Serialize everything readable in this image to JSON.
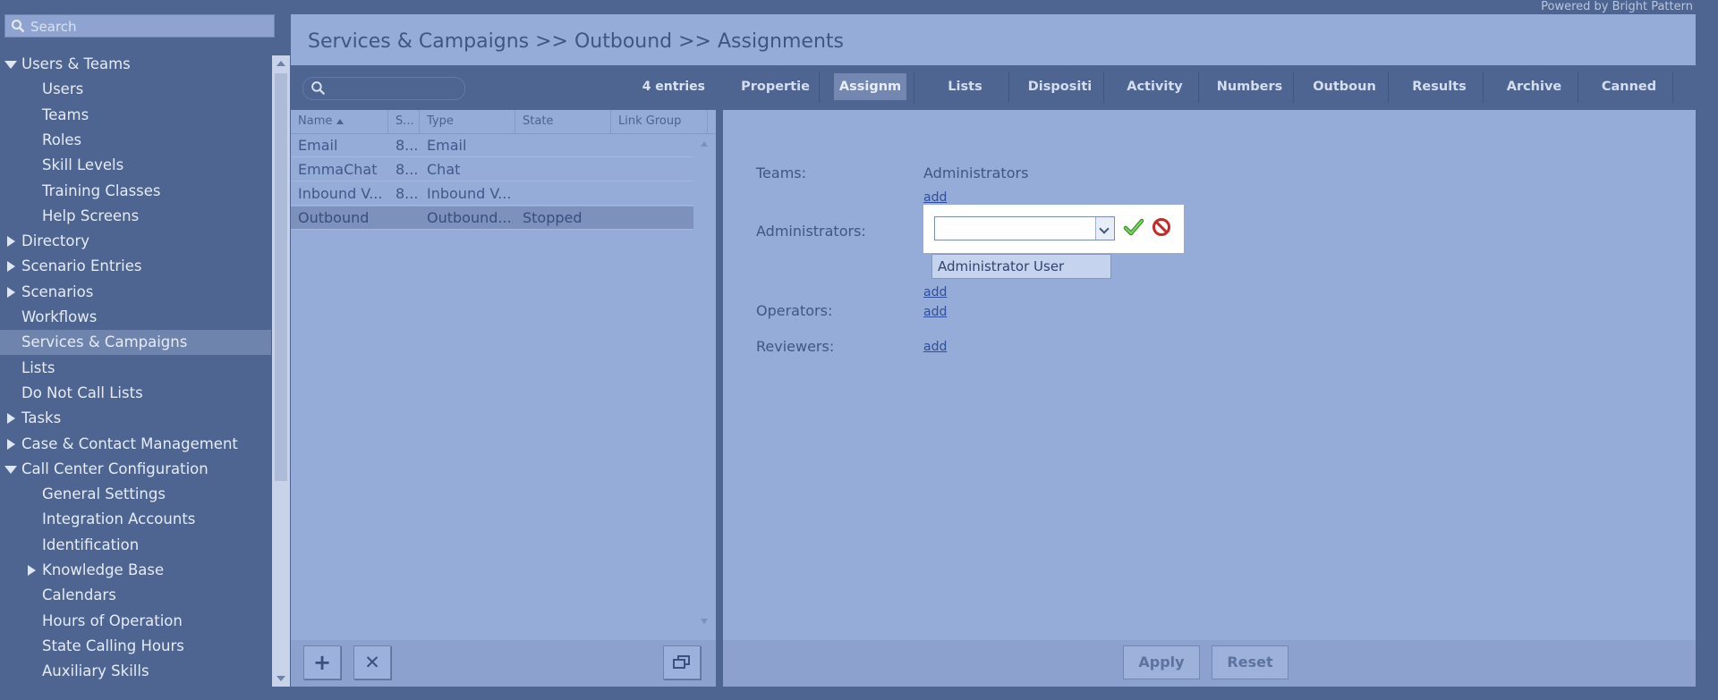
{
  "brand": {
    "powered_by": "Powered by Bright Pattern"
  },
  "sidebar": {
    "search_placeholder": "Search",
    "items": [
      {
        "label": "Users & Teams",
        "level": 0,
        "caret": "down"
      },
      {
        "label": "Users",
        "level": 1
      },
      {
        "label": "Teams",
        "level": 1
      },
      {
        "label": "Roles",
        "level": 1
      },
      {
        "label": "Skill Levels",
        "level": 1
      },
      {
        "label": "Training Classes",
        "level": 1
      },
      {
        "label": "Help Screens",
        "level": 1
      },
      {
        "label": "Directory",
        "level": 0,
        "caret": "right"
      },
      {
        "label": "Scenario Entries",
        "level": 0,
        "caret": "right"
      },
      {
        "label": "Scenarios",
        "level": 0,
        "caret": "right"
      },
      {
        "label": "Workflows",
        "level": 0
      },
      {
        "label": "Services & Campaigns",
        "level": 0,
        "active": true
      },
      {
        "label": "Lists",
        "level": 0
      },
      {
        "label": "Do Not Call Lists",
        "level": 0
      },
      {
        "label": "Tasks",
        "level": 0,
        "caret": "right"
      },
      {
        "label": "Case & Contact Management",
        "level": 0,
        "caret": "right"
      },
      {
        "label": "Call Center Configuration",
        "level": 0,
        "caret": "down"
      },
      {
        "label": "General Settings",
        "level": 1
      },
      {
        "label": "Integration Accounts",
        "level": 1
      },
      {
        "label": "Identification",
        "level": 1
      },
      {
        "label": "Knowledge Base",
        "level": 1,
        "caret": "right"
      },
      {
        "label": "Calendars",
        "level": 1
      },
      {
        "label": "Hours of Operation",
        "level": 1
      },
      {
        "label": "State Calling Hours",
        "level": 1
      },
      {
        "label": "Auxiliary Skills",
        "level": 1
      }
    ]
  },
  "main": {
    "title": "Services & Campaigns >> Outbound >> Assignments",
    "list": {
      "search_placeholder": "",
      "entries_count": "4 entries",
      "columns": [
        "Name",
        "S...",
        "Type",
        "State",
        "Link Group"
      ],
      "rows": [
        {
          "name": "Email",
          "s": "8...",
          "type": "Email",
          "state": "",
          "link": ""
        },
        {
          "name": "EmmaChat",
          "s": "8...",
          "type": "Chat",
          "state": "",
          "link": ""
        },
        {
          "name": "Inbound V...",
          "s": "8...",
          "type": "Inbound V...",
          "state": "",
          "link": ""
        },
        {
          "name": "Outbound",
          "s": "",
          "type": "Outbound...",
          "state": "Stopped",
          "link": "",
          "selected": true
        }
      ],
      "add_label": "+",
      "remove_label": "✕",
      "clone_icon": "copy-icon"
    },
    "tabs": [
      {
        "label": "Propertie"
      },
      {
        "label": "Assignm",
        "active": true
      },
      {
        "label": "Lists"
      },
      {
        "label": "Dispositi"
      },
      {
        "label": "Activity"
      },
      {
        "label": "Numbers"
      },
      {
        "label": "Outboun"
      },
      {
        "label": "Results"
      },
      {
        "label": "Archive"
      },
      {
        "label": "Canned"
      }
    ],
    "form": {
      "teams_label": "Teams:",
      "teams_value": "Administrators",
      "teams_add": "add",
      "administrators_label": "Administrators:",
      "administrators_combo_value": "",
      "administrators_option": "Administrator User",
      "administrators_add": "add",
      "operators_label": "Operators:",
      "operators_add": "add",
      "reviewers_label": "Reviewers:",
      "reviewers_add": "add"
    },
    "footer": {
      "apply_label": "Apply",
      "reset_label": "Reset"
    }
  }
}
